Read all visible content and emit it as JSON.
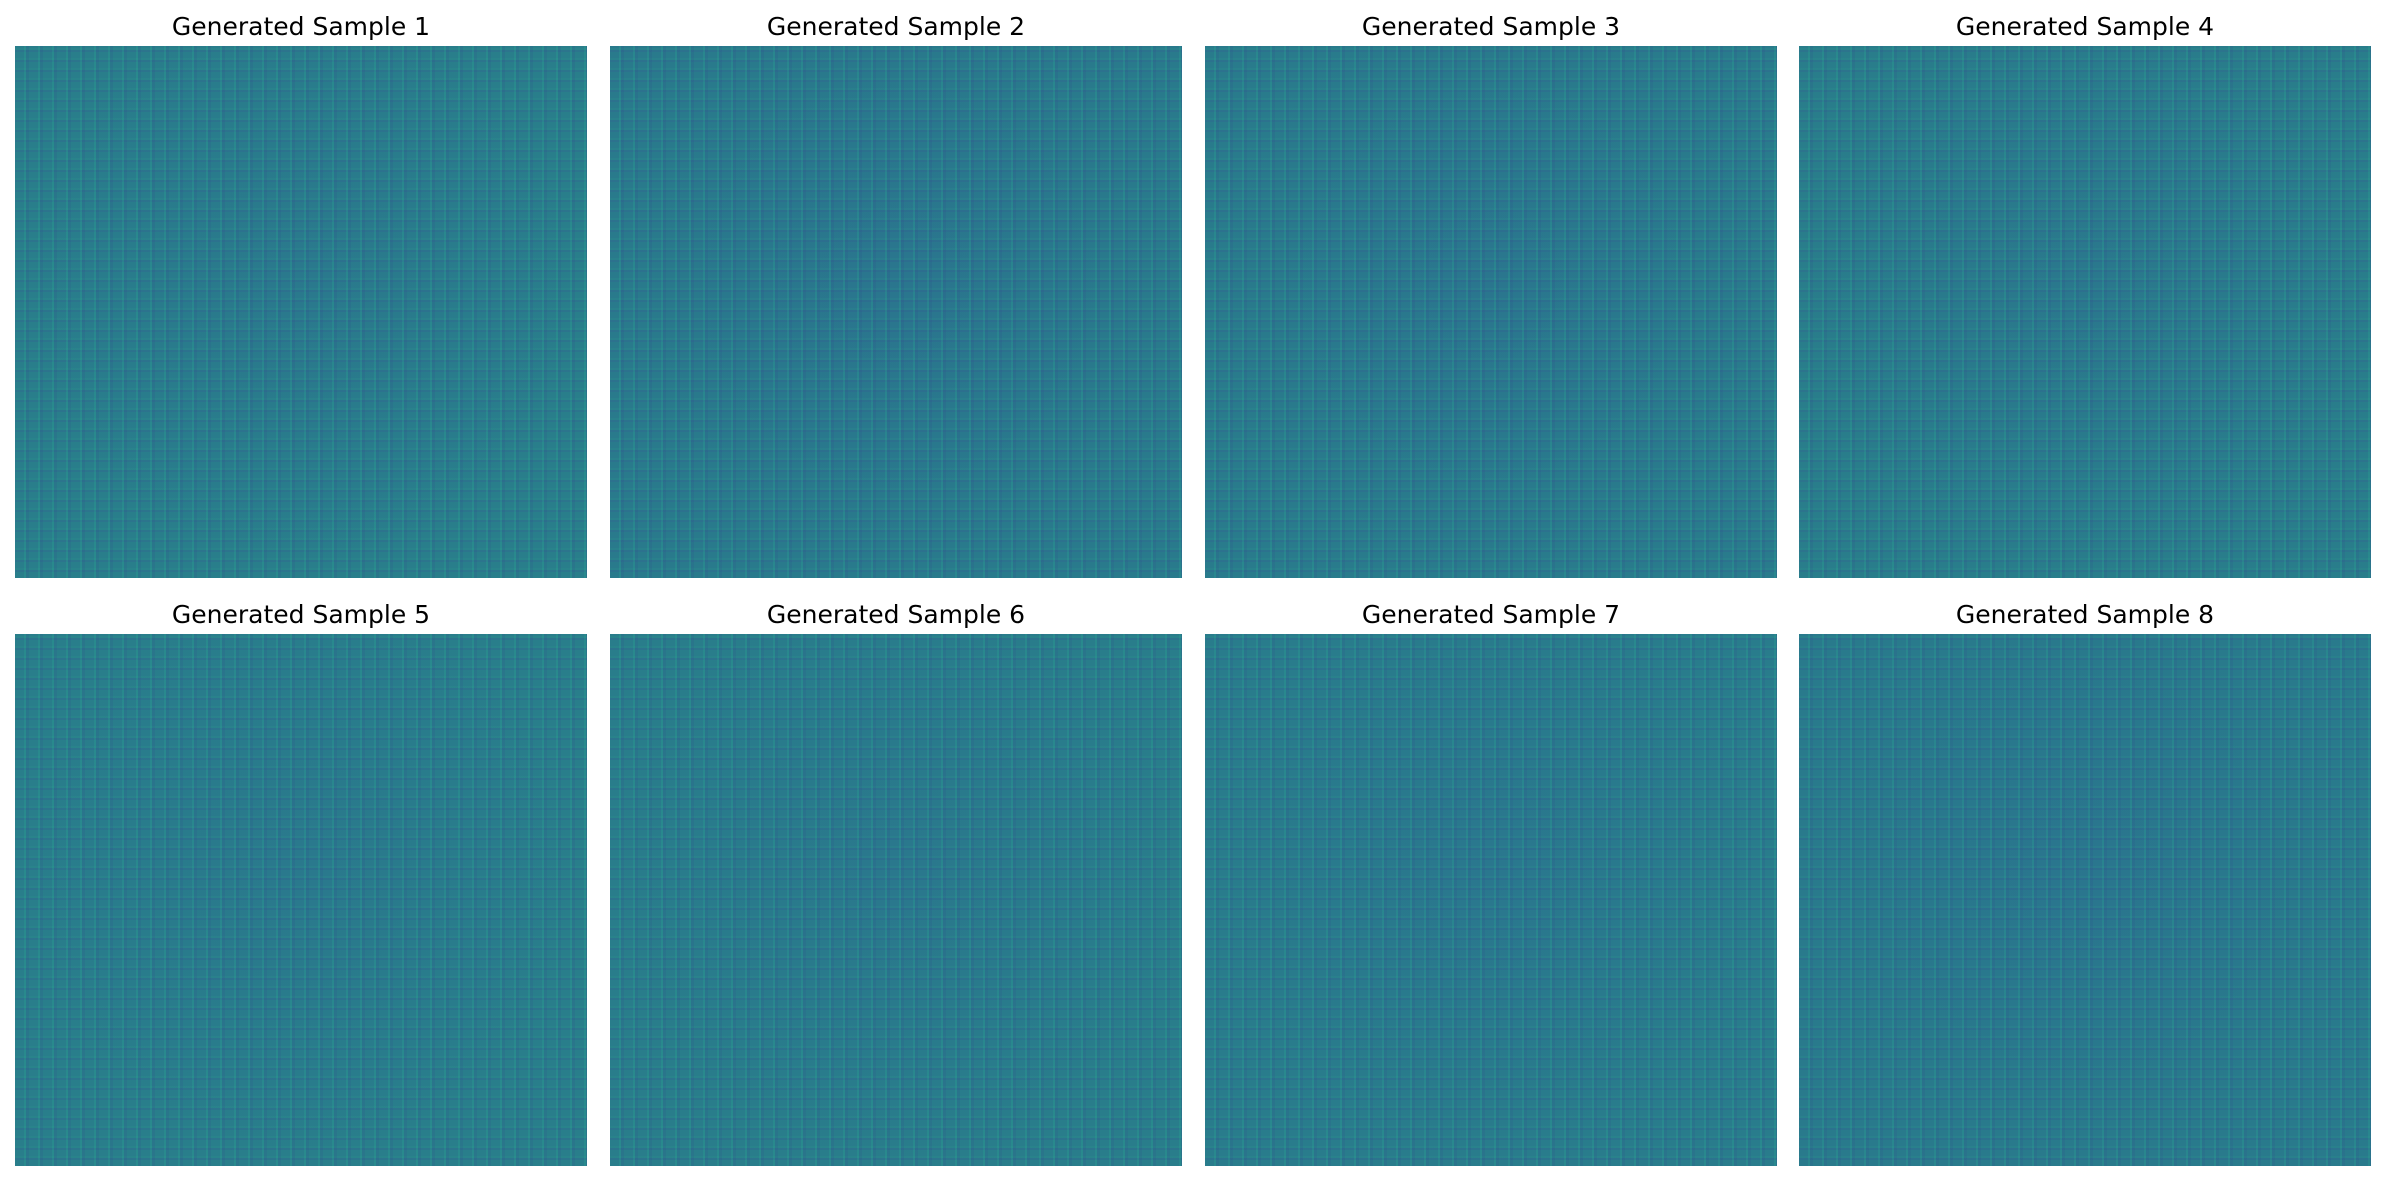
{
  "figure": {
    "panels": [
      {
        "title": "Generated Sample 1",
        "tint": "#2a7b8b"
      },
      {
        "title": "Generated Sample 2",
        "tint": "#2a778c"
      },
      {
        "title": "Generated Sample 3",
        "tint": "#2a788c"
      },
      {
        "title": "Generated Sample 4",
        "tint": "#2a7a8b"
      },
      {
        "title": "Generated Sample 5",
        "tint": "#2a7b8b"
      },
      {
        "title": "Generated Sample 6",
        "tint": "#2a7a8b"
      },
      {
        "title": "Generated Sample 7",
        "tint": "#2a798c"
      },
      {
        "title": "Generated Sample 8",
        "tint": "#2a778c"
      }
    ],
    "colors": {
      "background": "#ffffff",
      "image_base": "#2a7a8c",
      "pattern_green": "#28be96",
      "pattern_blue": "#323c8c"
    }
  }
}
